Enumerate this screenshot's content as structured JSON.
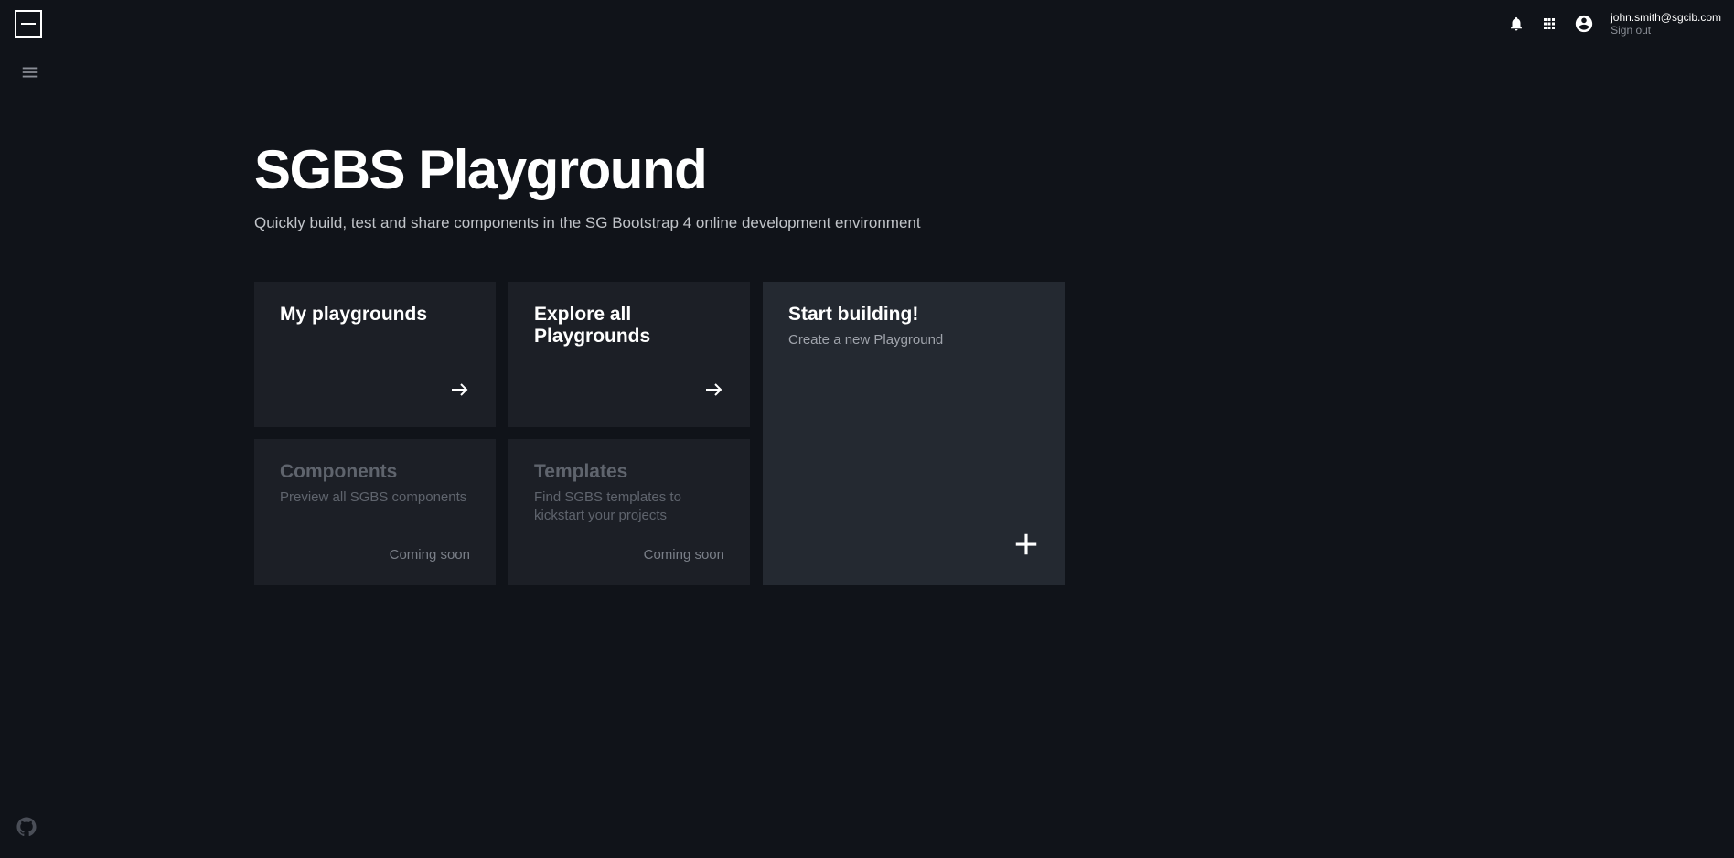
{
  "header": {
    "user_email": "john.smith@sgcib.com",
    "sign_out": "Sign out"
  },
  "page": {
    "title": "SGBS Playground",
    "subtitle": "Quickly build, test and share components in the SG Bootstrap 4 online development environment"
  },
  "cards": {
    "my_playgrounds": {
      "title": "My playgrounds"
    },
    "explore": {
      "title": "Explore all Playgrounds"
    },
    "components": {
      "title": "Components",
      "desc": "Preview all SGBS components",
      "footer": "Coming soon"
    },
    "templates": {
      "title": "Templates",
      "desc": "Find SGBS templates to kickstart your projects",
      "footer": "Coming soon"
    },
    "start": {
      "title": "Start building!",
      "desc": "Create a new Playground"
    }
  }
}
